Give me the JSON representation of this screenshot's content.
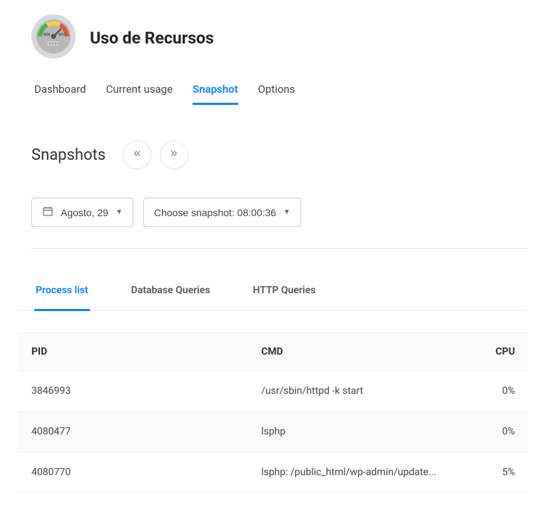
{
  "header": {
    "title": "Uso de Recursos"
  },
  "mainTabs": [
    {
      "label": "Dashboard",
      "active": false
    },
    {
      "label": "Current usage",
      "active": false
    },
    {
      "label": "Snapshot",
      "active": true
    },
    {
      "label": "Options",
      "active": false
    }
  ],
  "section": {
    "title": "Snapshots"
  },
  "controls": {
    "datePicker": "Agosto, 29",
    "snapshotPicker": "Choose snapshot: 08:00:36"
  },
  "subTabs": [
    {
      "label": "Process list",
      "active": true
    },
    {
      "label": "Database Queries",
      "active": false
    },
    {
      "label": "HTTP Queries",
      "active": false
    }
  ],
  "table": {
    "columns": [
      "PID",
      "CMD",
      "CPU"
    ],
    "rows": [
      {
        "pid": "3846993",
        "cmd": "/usr/sbin/httpd -k start",
        "cpu": "0%"
      },
      {
        "pid": "4080477",
        "cmd": "lsphp",
        "cpu": "0%"
      },
      {
        "pid": "4080770",
        "cmd": "lsphp:        /public_html/wp-admin/update...",
        "cpu": "5%"
      }
    ]
  }
}
